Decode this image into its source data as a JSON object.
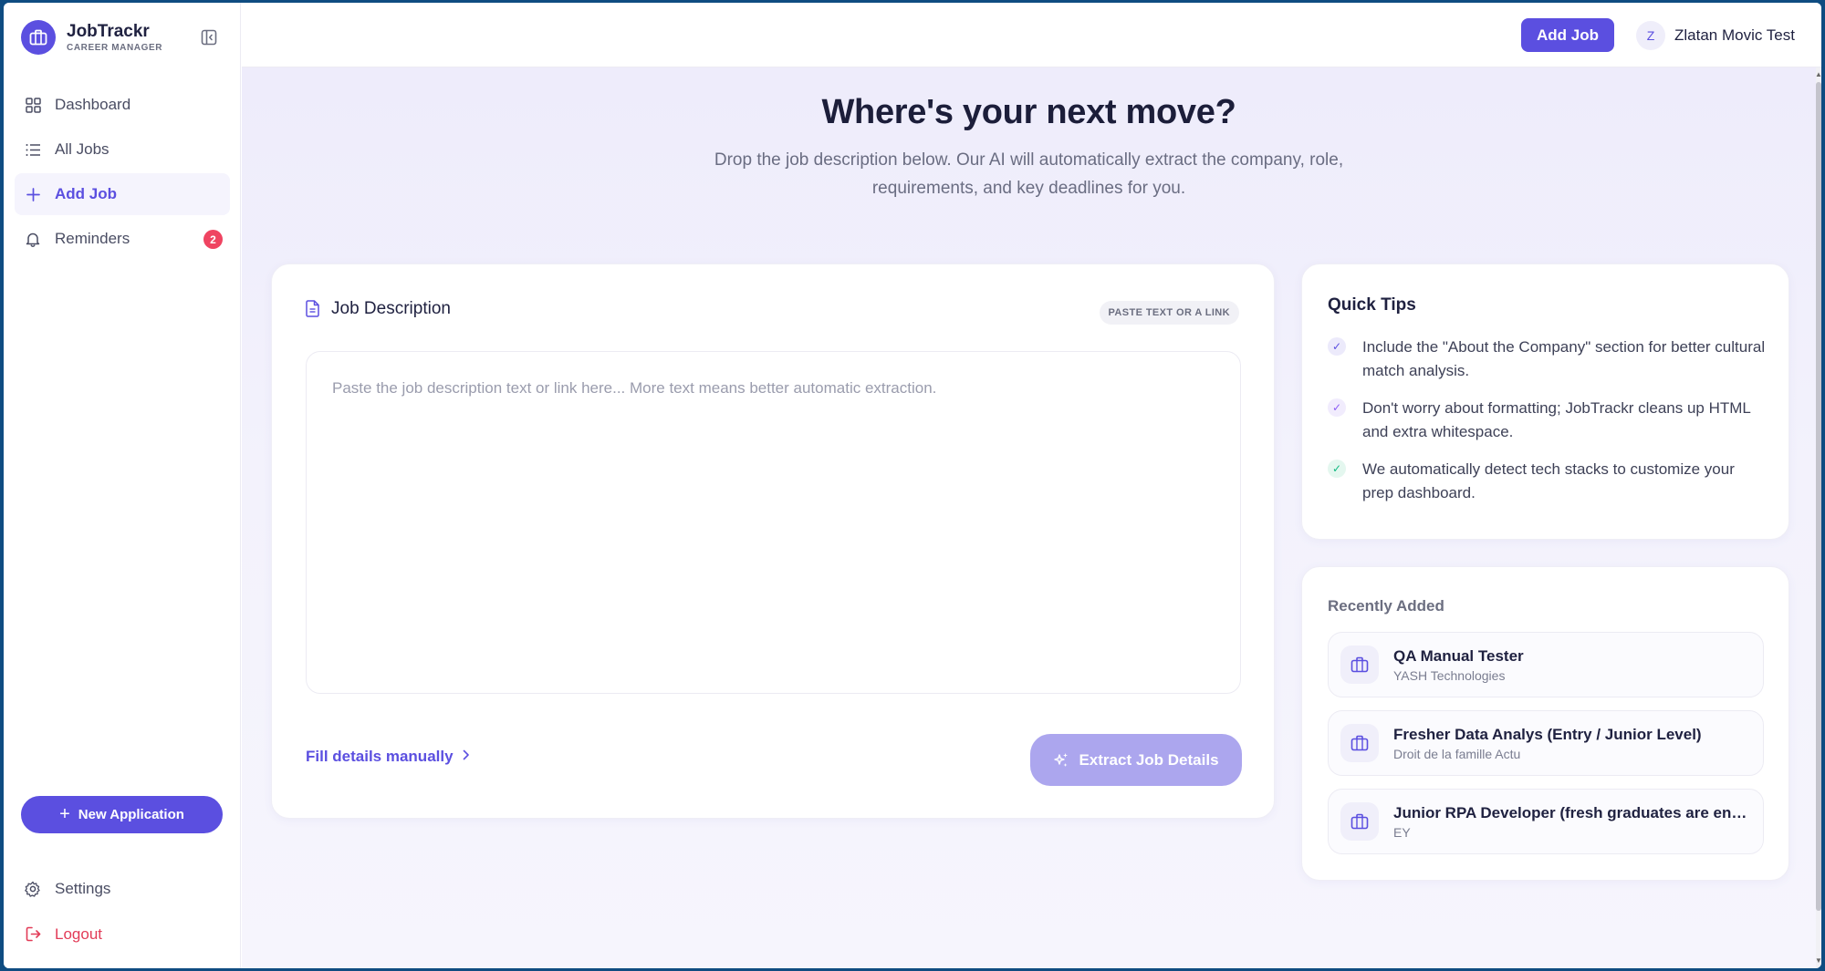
{
  "brand": {
    "name": "JobTrackr",
    "subtitle": "CAREER MANAGER"
  },
  "sidebar": {
    "items": [
      {
        "label": "Dashboard",
        "icon": "grid-icon"
      },
      {
        "label": "All Jobs",
        "icon": "list-icon"
      },
      {
        "label": "Add Job",
        "icon": "plus-icon",
        "active": true
      },
      {
        "label": "Reminders",
        "icon": "bell-icon",
        "badge": "2"
      }
    ],
    "new_application_label": "New Application",
    "bottom_items": [
      {
        "label": "Settings",
        "icon": "gear-icon"
      },
      {
        "label": "Logout",
        "icon": "logout-icon"
      }
    ]
  },
  "topbar": {
    "add_job_label": "Add Job",
    "user": {
      "initial": "Z",
      "name": "Zlatan Movic Test"
    }
  },
  "hero": {
    "title": "Where's your next move?",
    "subtitle": "Drop the job description below. Our AI will automatically extract the company, role, requirements, and key deadlines for you."
  },
  "job_description": {
    "title": "Job Description",
    "pill": "PASTE TEXT OR A LINK",
    "value": "",
    "placeholder": "Paste the job description text or link here... More text means better automatic extraction.",
    "fill_manually_label": "Fill details manually",
    "extract_label": "Extract Job Details"
  },
  "quick_tips": {
    "title": "Quick Tips",
    "items": [
      {
        "text": "Include the \"About the Company\" section for better cultural match analysis.",
        "color": "#5b4fe0",
        "bg": "#eceafb"
      },
      {
        "text": "Don't worry about formatting; JobTrackr cleans up HTML and extra whitespace.",
        "color": "#8b5cf6",
        "bg": "#f1ecfd"
      },
      {
        "text": "We automatically detect tech stacks to customize your prep dashboard.",
        "color": "#10b981",
        "bg": "#e4f7ef"
      }
    ]
  },
  "recently_added": {
    "title": "Recently Added",
    "items": [
      {
        "role": "QA Manual Tester",
        "company": "YASH Technologies"
      },
      {
        "role": "Fresher Data Analys (Entry / Junior Level)",
        "company": "Droit de la famille Actu"
      },
      {
        "role": "Junior RPA Developer (fresh graduates are enco...",
        "company": "EY"
      }
    ]
  },
  "colors": {
    "accent": "#5b4fe0",
    "danger": "#ef4461",
    "extract_disabled": "#aca6ee"
  }
}
